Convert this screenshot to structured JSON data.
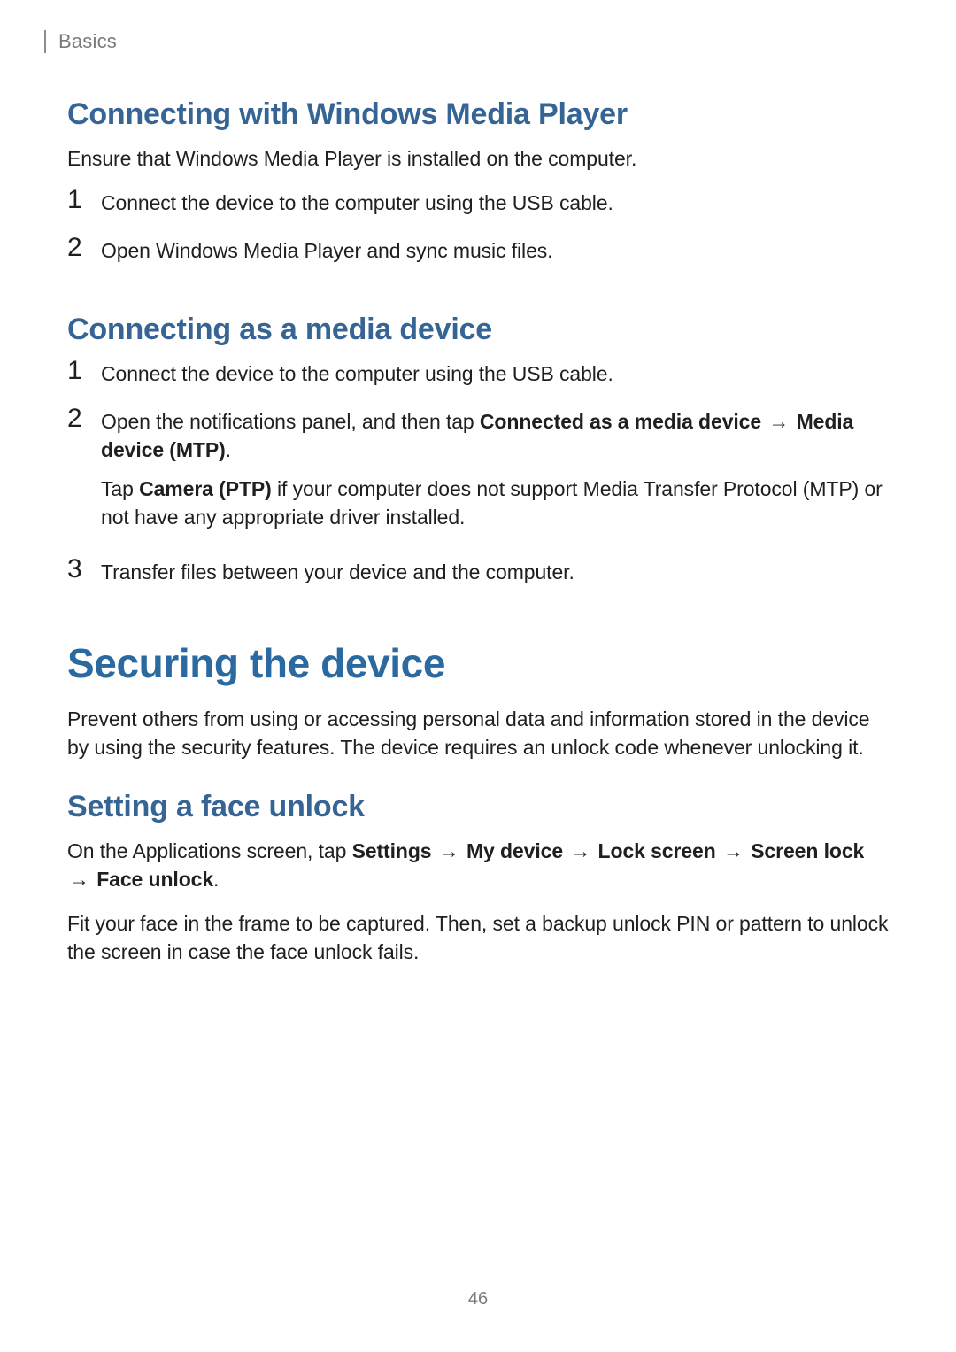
{
  "section_label": "Basics",
  "arrow": "→",
  "wmp": {
    "heading": "Connecting with Windows Media Player",
    "intro": "Ensure that Windows Media Player is installed on the computer.",
    "steps": [
      {
        "num": "1",
        "text": "Connect the device to the computer using the USB cable."
      },
      {
        "num": "2",
        "text": "Open Windows Media Player and sync music files."
      }
    ]
  },
  "media": {
    "heading": "Connecting as a media device",
    "steps": {
      "s1": {
        "num": "1",
        "text": "Connect the device to the computer using the USB cable."
      },
      "s2": {
        "num": "2",
        "p1_pre": "Open the notifications panel, and then tap ",
        "p1_bold1": "Connected as a media device",
        "p1_mid": " ",
        "p1_bold2": "Media device (MTP)",
        "p1_post": ".",
        "p2_pre": "Tap ",
        "p2_bold": "Camera (PTP)",
        "p2_post": " if your computer does not support Media Transfer Protocol (MTP) or not have any appropriate driver installed."
      },
      "s3": {
        "num": "3",
        "text": "Transfer files between your device and the computer."
      }
    }
  },
  "securing": {
    "title": "Securing the device",
    "intro": "Prevent others from using or accessing personal data and information stored in the device by using the security features. The device requires an unlock code whenever unlocking it."
  },
  "face": {
    "heading": "Setting a face unlock",
    "p1_pre": "On the Applications screen, tap ",
    "p1_b1": "Settings",
    "p1_b2": "My device",
    "p1_b3": "Lock screen",
    "p1_b4": "Screen lock",
    "p1_b5": "Face unlock",
    "p1_post": ".",
    "p2": "Fit your face in the frame to be captured. Then, set a backup unlock PIN or pattern to unlock the screen in case the face unlock fails."
  },
  "page_number": "46"
}
